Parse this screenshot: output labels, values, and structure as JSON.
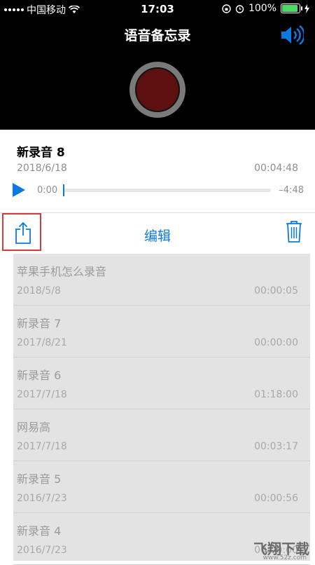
{
  "status_bar": {
    "carrier": "中国移动",
    "time": "17:03",
    "battery": "100%",
    "battery_level": 1.0
  },
  "header": {
    "title": "语音备忘录"
  },
  "current_recording": {
    "name": "新录音 8",
    "date": "2018/6/18",
    "duration": "00:04:48",
    "position": "0:00",
    "remaining": "–4:48",
    "progress": 0.0
  },
  "actions": {
    "edit_label": "编辑"
  },
  "recordings": [
    {
      "name": "苹果手机怎么录音",
      "date": "2018/5/8",
      "duration": "00:00:05"
    },
    {
      "name": "新录音 7",
      "date": "2017/8/21",
      "duration": "00:00:00"
    },
    {
      "name": "新录音 6",
      "date": "2017/7/18",
      "duration": "01:18:00"
    },
    {
      "name": "网易高",
      "date": "2017/7/18",
      "duration": "00:03:17"
    },
    {
      "name": "新录音 5",
      "date": "2016/7/23",
      "duration": "00:00:56"
    },
    {
      "name": "新录音 4",
      "date": "2016/7/23",
      "duration": "00:00:00"
    }
  ],
  "watermark": {
    "text": "飞翔下载",
    "url": "www.52z.com"
  },
  "colors": {
    "accent": "#0a7ae0",
    "record": "#5e1010",
    "highlight_box": "#d43b3b"
  }
}
